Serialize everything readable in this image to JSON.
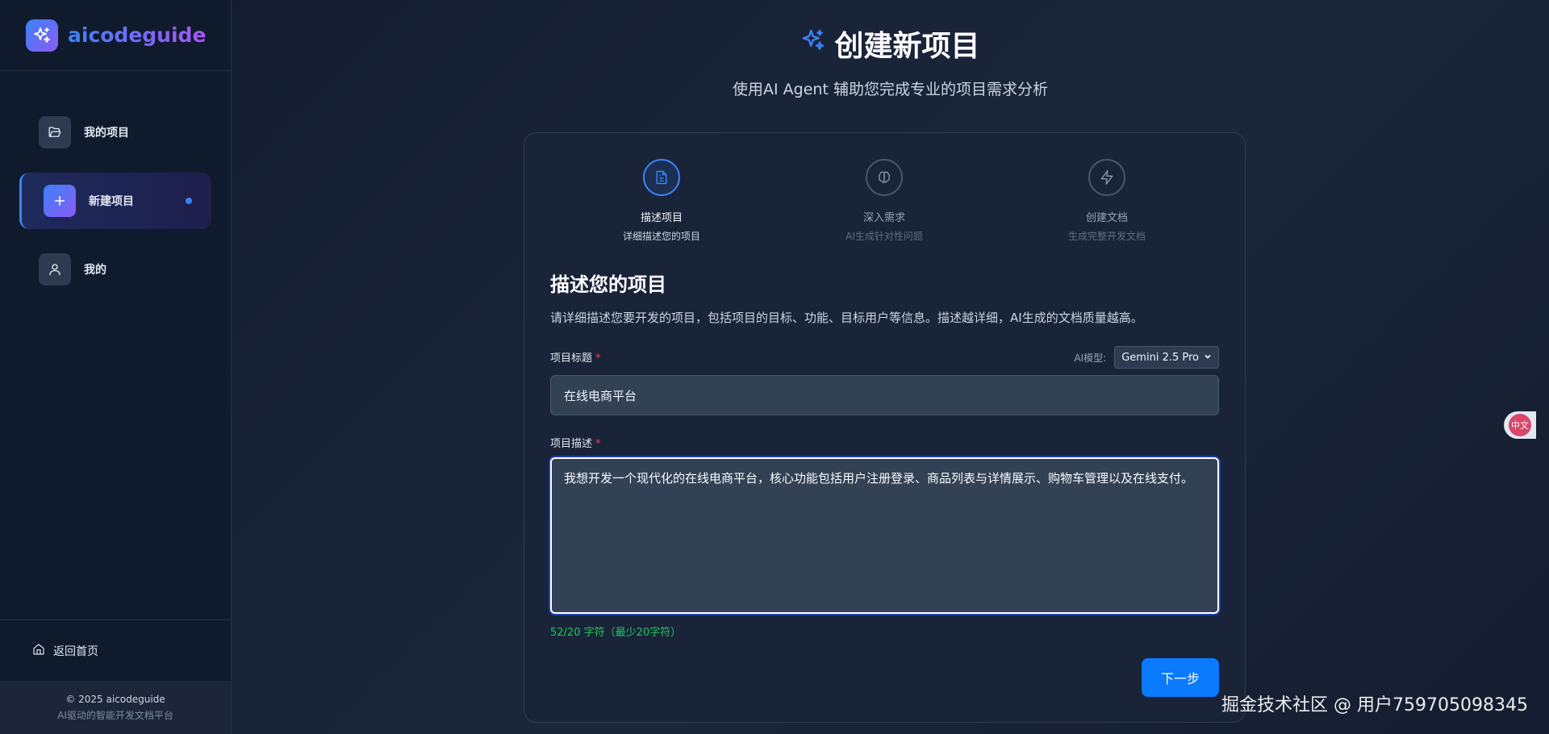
{
  "brand": {
    "name": "aicodeguide"
  },
  "sidebar": {
    "items": [
      {
        "label": "我的项目"
      },
      {
        "label": "新建项目"
      },
      {
        "label": "我的"
      }
    ],
    "back_home": "返回首页",
    "footer": {
      "copyright": "© 2025 aicodeguide",
      "tagline": "AI驱动的智能开发文档平台"
    }
  },
  "header": {
    "title": "创建新项目",
    "subtitle": "使用AI Agent 辅助您完成专业的项目需求分析"
  },
  "steps": [
    {
      "title": "描述项目",
      "desc": "详细描述您的项目",
      "active": true
    },
    {
      "title": "深入需求",
      "desc": "AI生成针对性问题",
      "active": false
    },
    {
      "title": "创建文档",
      "desc": "生成完整开发文档",
      "active": false
    }
  ],
  "form": {
    "section_title": "描述您的项目",
    "section_desc": "请详细描述您要开发的项目，包括项目的目标、功能、目标用户等信息。描述越详细，AI生成的文档质量越高。",
    "title_label": "项目标题",
    "required_mark": "*",
    "model_label": "AI模型:",
    "model_value": "Gemini 2.5 Pro",
    "title_value": "在线电商平台",
    "desc_label": "项目描述",
    "desc_value": "我想开发一个现代化的在线电商平台，核心功能包括用户注册登录、商品列表与详情展示、购物车管理以及在线支付。",
    "char_count": "52/20 字符（最少20字符）",
    "next_button": "下一步"
  },
  "float_widget": {
    "label": "中文"
  },
  "watermark": "掘金技术社区 @ 用户759705098345",
  "colors": {
    "accent": "#3b82f6",
    "button": "#0a7aff",
    "success": "#22c55e",
    "required": "#ef4444"
  }
}
